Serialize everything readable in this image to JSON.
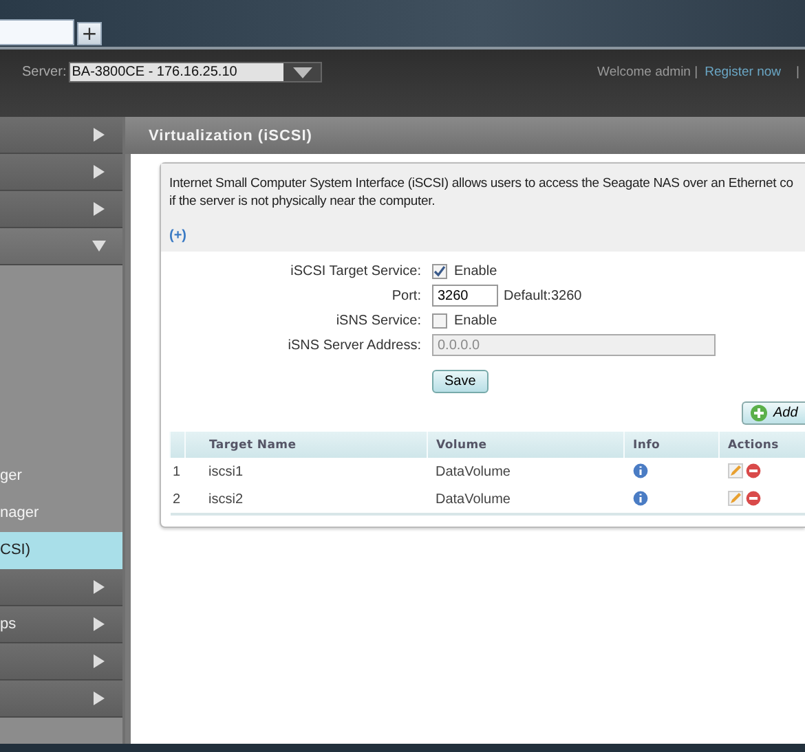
{
  "browser": {
    "new_tab": "+"
  },
  "header": {
    "server_label": "Server:",
    "server_value": "BA-3800CE - 176.16.25.10",
    "welcome": "Welcome admin |",
    "register": "Register now",
    "separator": "|"
  },
  "sidebar": {
    "items": [
      {
        "expanded": false
      },
      {
        "expanded": false
      },
      {
        "expanded": false
      },
      {
        "expanded": true,
        "children": [
          {
            "label": "ger",
            "selected": false
          },
          {
            "label": "nager",
            "selected": false
          },
          {
            "label": "CSI)",
            "selected": true
          }
        ]
      },
      {
        "expanded": false
      },
      {
        "label": "ps",
        "expanded": false
      },
      {
        "expanded": false
      },
      {
        "expanded": false
      }
    ]
  },
  "page": {
    "title": "Virtualization (iSCSI)",
    "description": [
      "Internet Small Computer System Interface (iSCSI) allows users to access the Seagate NAS over an Ethernet co",
      "if the server is not physically near the computer."
    ],
    "more_link": "(+)",
    "form": [
      {
        "kind": "checkbox",
        "label": "iSCSI Target Service:",
        "text": "Enable",
        "checked": true
      },
      {
        "kind": "text",
        "label": "Port:",
        "value": "3260",
        "hint": "Default:3260"
      },
      {
        "kind": "checkbox",
        "label": "iSNS Service:",
        "text": "Enable",
        "checked": false
      },
      {
        "kind": "address",
        "label": "iSNS Server Address:",
        "value": "0.0.0.0",
        "disabled": true
      }
    ],
    "save": "Save",
    "add": "Add",
    "table": {
      "columns": [
        "",
        "Target Name",
        "Volume",
        "Info",
        "Actions"
      ],
      "rows": [
        {
          "index": "1",
          "name": "iscsi1",
          "volume": "DataVolume"
        },
        {
          "index": "2",
          "name": "iscsi2",
          "volume": "DataVolume"
        }
      ]
    }
  }
}
